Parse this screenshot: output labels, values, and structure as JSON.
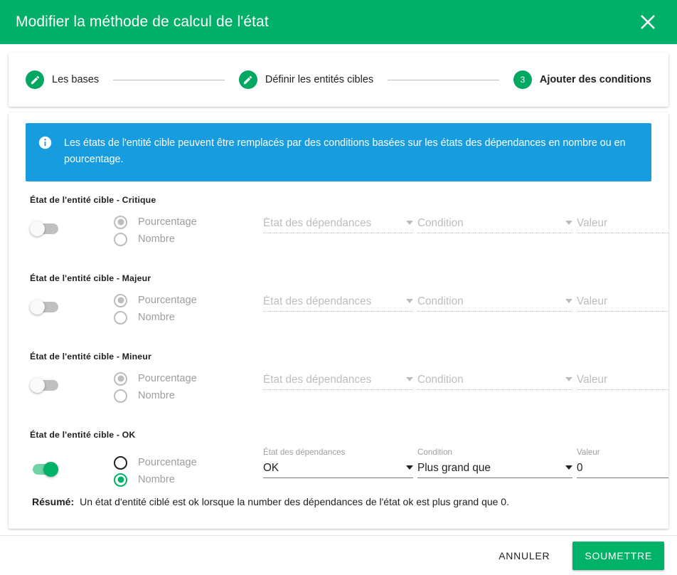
{
  "dialog": {
    "title": "Modifier la méthode de calcul de l'état",
    "close_icon": "close-icon",
    "header_color": "#00b068"
  },
  "stepper": {
    "steps": [
      {
        "badge": "edit-icon",
        "label": "Les bases",
        "state": "done"
      },
      {
        "badge": "edit-icon",
        "label": "Définir les entités cibles",
        "state": "done"
      },
      {
        "badge": "3",
        "label": "Ajouter des conditions",
        "state": "active"
      }
    ]
  },
  "banner": {
    "icon": "info-icon",
    "color": "#179ce0",
    "text": "Les états de l'entité cible peuvent être remplacés par des conditions basées sur les états des dépendances en nombre ou en pourcentage."
  },
  "conditions": [
    {
      "title": "État de l'entité cible - Critique",
      "enabled": false,
      "radios": [
        {
          "label": "Pourcentage",
          "checked": true
        },
        {
          "label": "Nombre",
          "checked": false
        }
      ],
      "dependency_state": {
        "label": "État des dépendances",
        "value": "",
        "placeholder": "État des dépendances"
      },
      "condition": {
        "label": "Condition",
        "value": "",
        "placeholder": "Condition"
      },
      "value_field": {
        "label": "Valeur",
        "value": "",
        "placeholder": "Valeur"
      }
    },
    {
      "title": "État de l'entité cible - Majeur",
      "enabled": false,
      "radios": [
        {
          "label": "Pourcentage",
          "checked": true
        },
        {
          "label": "Nombre",
          "checked": false
        }
      ],
      "dependency_state": {
        "label": "État des dépendances",
        "value": "",
        "placeholder": "État des dépendances"
      },
      "condition": {
        "label": "Condition",
        "value": "",
        "placeholder": "Condition"
      },
      "value_field": {
        "label": "Valeur",
        "value": "",
        "placeholder": "Valeur"
      }
    },
    {
      "title": "État de l'entité cible - Mineur",
      "enabled": false,
      "radios": [
        {
          "label": "Pourcentage",
          "checked": true
        },
        {
          "label": "Nombre",
          "checked": false
        }
      ],
      "dependency_state": {
        "label": "État des dépendances",
        "value": "",
        "placeholder": "État des dépendances"
      },
      "condition": {
        "label": "Condition",
        "value": "",
        "placeholder": "Condition"
      },
      "value_field": {
        "label": "Valeur",
        "value": "",
        "placeholder": "Valeur"
      }
    },
    {
      "title": "État de l'entité cible - OK",
      "enabled": true,
      "radios": [
        {
          "label": "Pourcentage",
          "checked": false
        },
        {
          "label": "Nombre",
          "checked": true
        }
      ],
      "dependency_state": {
        "label": "État des dépendances",
        "value": "OK",
        "placeholder": "État des dépendances"
      },
      "condition": {
        "label": "Condition",
        "value": "Plus grand que",
        "placeholder": "Condition"
      },
      "value_field": {
        "label": "Valeur",
        "value": "0",
        "placeholder": "Valeur"
      }
    }
  ],
  "resume": {
    "label": "Résumé:",
    "text": "Un état d'entité ciblé est ok lorsque la number des dépendances de l'état ok est plus grand que 0."
  },
  "footer": {
    "cancel_label": "ANNULER",
    "submit_label": "SOUMETTRE",
    "submit_color": "#00b267"
  }
}
